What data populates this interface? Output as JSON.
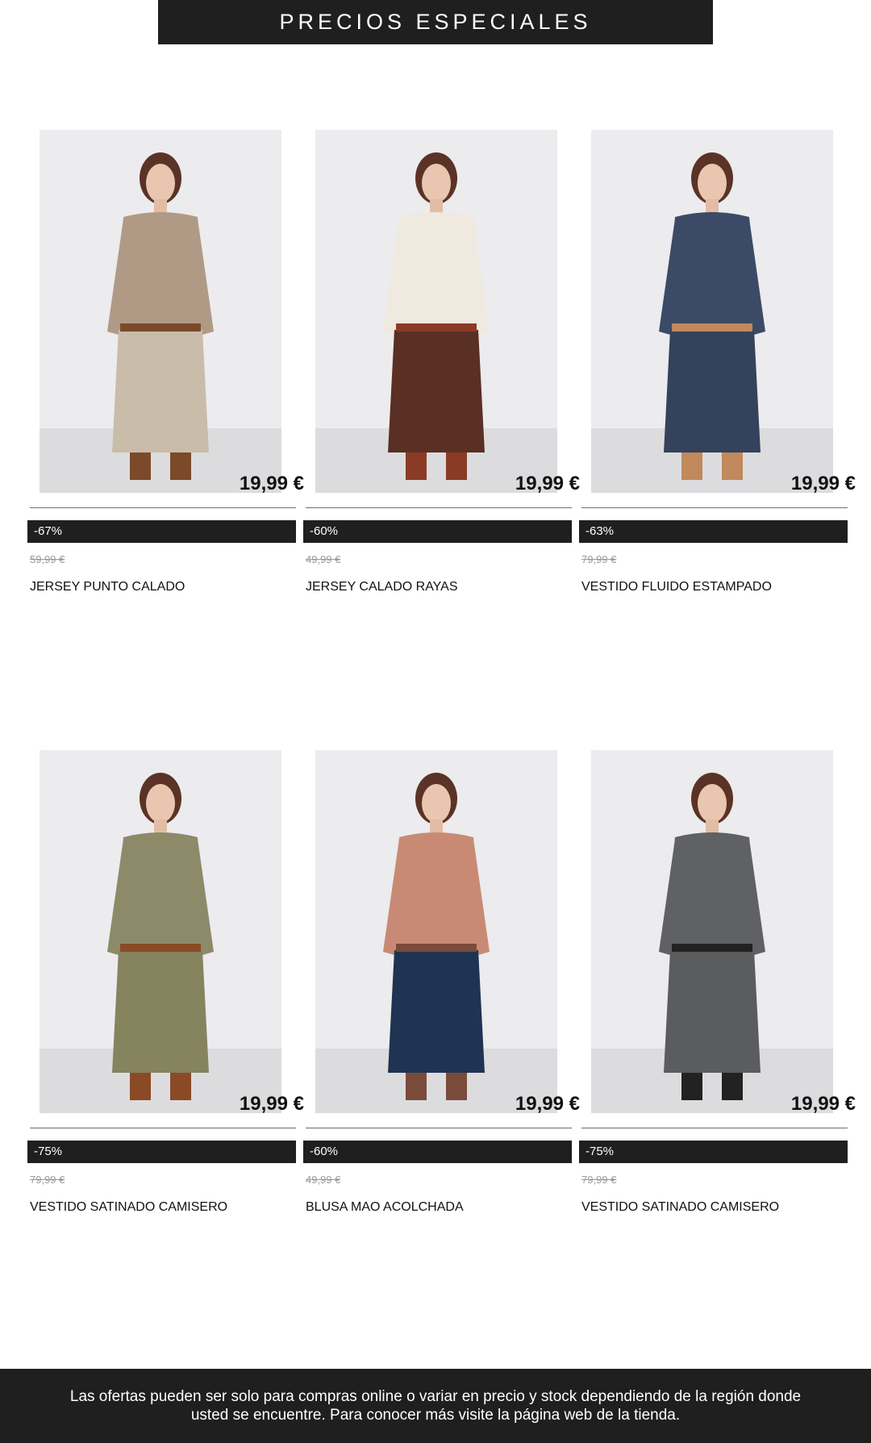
{
  "banner": {
    "title": "PRECIOS ESPECIALES"
  },
  "products": [
    {
      "price": "19,99 €",
      "discount": "-67%",
      "old_price": "59,99 €",
      "name": "JERSEY PUNTO CALADO",
      "image_icon": "woman-knit-sweater-boots-photo",
      "colors": {
        "top": "#b09a86",
        "bottom": "#c9bca9",
        "accent": "#7a4a2a"
      }
    },
    {
      "price": "19,99 €",
      "discount": "-60%",
      "old_price": "49,99 €",
      "name": "JERSEY CALADO RAYAS",
      "image_icon": "woman-white-openknit-sweater-photo",
      "colors": {
        "top": "#efe9df",
        "bottom": "#5a2f24",
        "accent": "#8a3b26"
      }
    },
    {
      "price": "19,99 €",
      "discount": "-63%",
      "old_price": "79,99 €",
      "name": "VESTIDO FLUIDO ESTAMPADO",
      "image_icon": "woman-printed-maxi-dress-photo",
      "colors": {
        "top": "#3b4a66",
        "bottom": "#34425c",
        "accent": "#c1895c"
      }
    },
    {
      "price": "19,99 €",
      "discount": "-75%",
      "old_price": "79,99 €",
      "name": "VESTIDO SATINADO CAMISERO",
      "image_icon": "woman-olive-satin-shirt-dress-photo",
      "colors": {
        "top": "#8d8a6a",
        "bottom": "#86835f",
        "accent": "#8b4a26"
      }
    },
    {
      "price": "19,99 €",
      "discount": "-60%",
      "old_price": "49,99 €",
      "name": "BLUSA MAO ACOLCHADA",
      "image_icon": "woman-floral-blouse-photo",
      "colors": {
        "top": "#c88a74",
        "bottom": "#1f3352",
        "accent": "#7a4b3a"
      }
    },
    {
      "price": "19,99 €",
      "discount": "-75%",
      "old_price": "79,99 €",
      "name": "VESTIDO SATINADO CAMISERO",
      "image_icon": "woman-grey-satin-shirt-dress-photo",
      "colors": {
        "top": "#5f6163",
        "bottom": "#5a5c5e",
        "accent": "#222222"
      }
    }
  ],
  "footer": {
    "note": "Las ofertas pueden ser solo para compras online o variar en precio y stock dependiendo de la región donde usted se encuentre. Para conocer más visite la página web de la tienda."
  }
}
